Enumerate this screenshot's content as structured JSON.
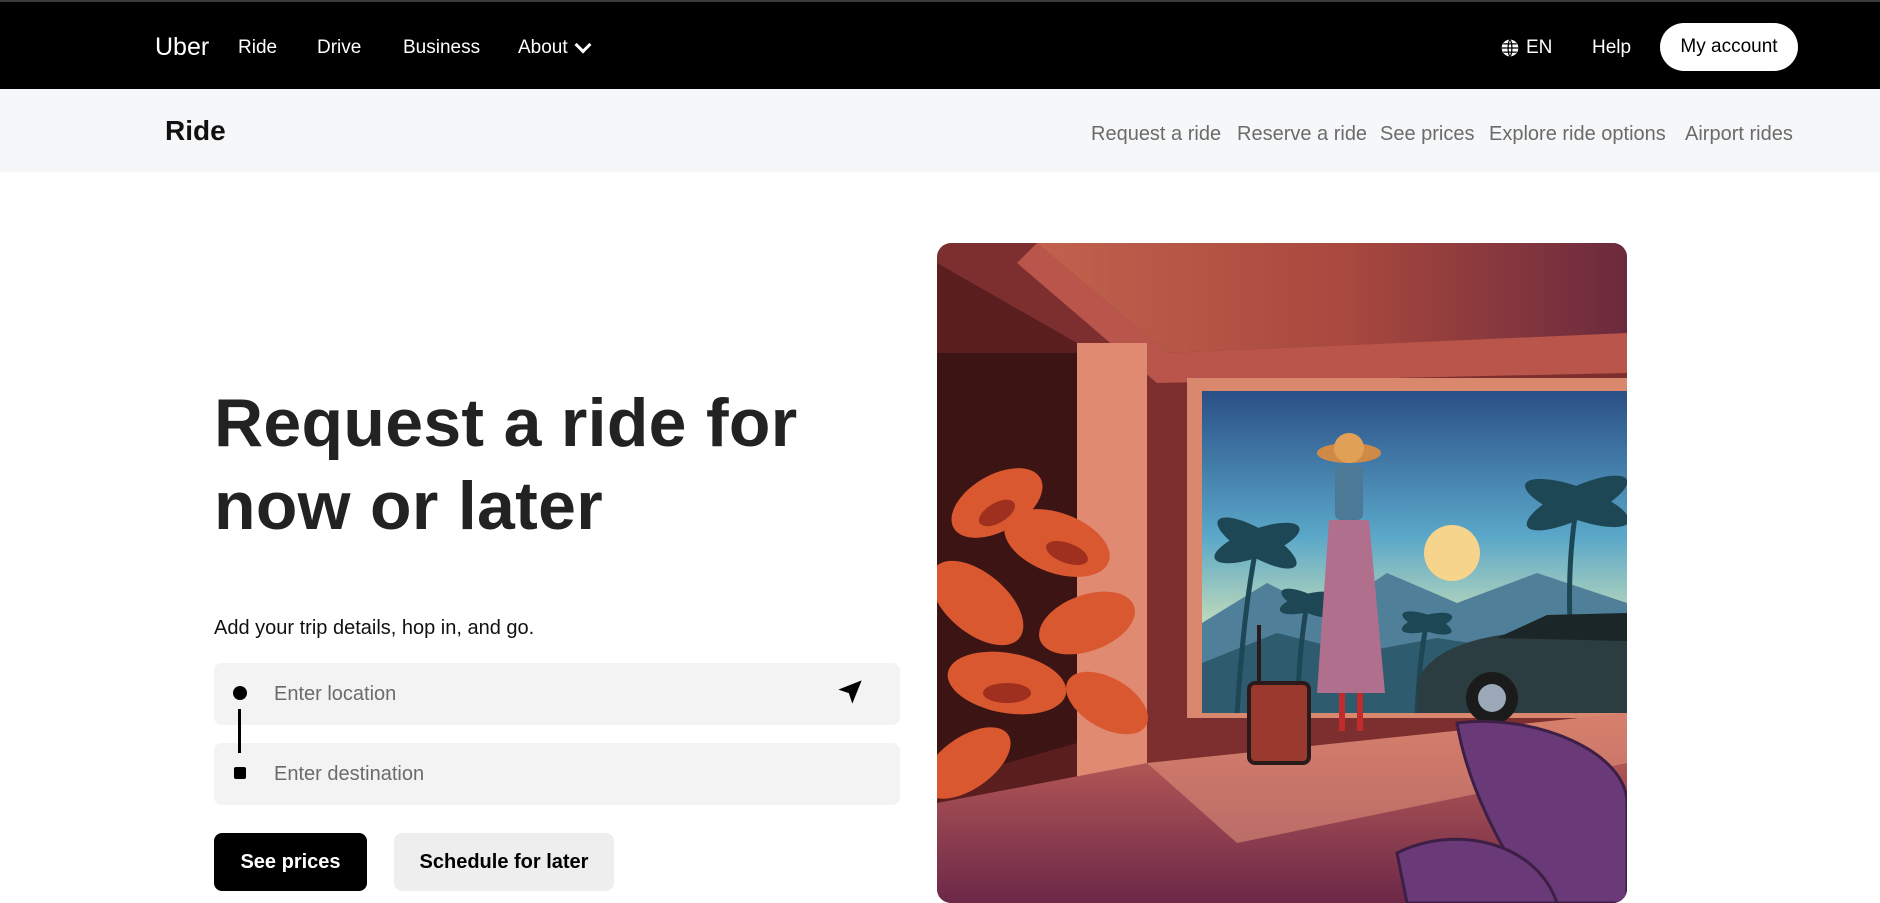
{
  "topnav": {
    "brand": "Uber",
    "links": [
      "Ride",
      "Drive",
      "Business",
      "About"
    ],
    "language": "EN",
    "help": "Help",
    "account": "My account"
  },
  "subnav": {
    "title": "Ride",
    "links": [
      "Request a ride",
      "Reserve a ride",
      "See prices",
      "Explore ride options",
      "Airport rides"
    ]
  },
  "hero": {
    "headline": "Request a ride for now or later",
    "subtext": "Add your trip details, hop in, and go.",
    "location_placeholder": "Enter location",
    "destination_placeholder": "Enter destination",
    "primary_button": "See prices",
    "secondary_button": "Schedule for later"
  },
  "colors": {
    "nav_bg": "#000000",
    "subnav_bg": "#f6f7f8",
    "field_bg": "#f3f3f3",
    "muted_text": "#6b6b6b"
  },
  "icons": [
    "globe-icon",
    "chevron-down-icon",
    "navigation-arrow-icon",
    "pickup-dot-icon",
    "destination-square-icon"
  ]
}
